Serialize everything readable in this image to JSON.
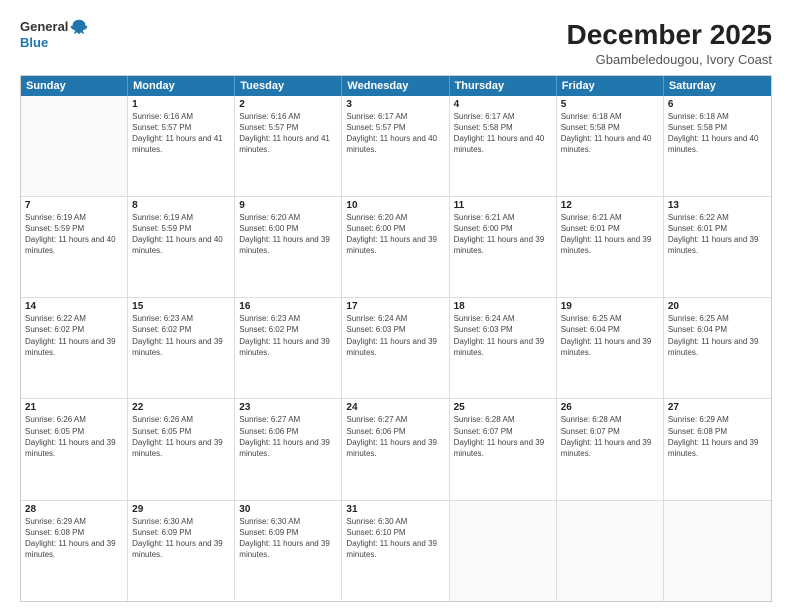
{
  "header": {
    "logo_line1": "General",
    "logo_line2": "Blue",
    "title": "December 2025",
    "subtitle": "Gbambeledougou, Ivory Coast"
  },
  "days_of_week": [
    "Sunday",
    "Monday",
    "Tuesday",
    "Wednesday",
    "Thursday",
    "Friday",
    "Saturday"
  ],
  "weeks": [
    [
      {
        "day": "",
        "sunrise": "",
        "sunset": "",
        "daylight": ""
      },
      {
        "day": "1",
        "sunrise": "Sunrise: 6:16 AM",
        "sunset": "Sunset: 5:57 PM",
        "daylight": "Daylight: 11 hours and 41 minutes."
      },
      {
        "day": "2",
        "sunrise": "Sunrise: 6:16 AM",
        "sunset": "Sunset: 5:57 PM",
        "daylight": "Daylight: 11 hours and 41 minutes."
      },
      {
        "day": "3",
        "sunrise": "Sunrise: 6:17 AM",
        "sunset": "Sunset: 5:57 PM",
        "daylight": "Daylight: 11 hours and 40 minutes."
      },
      {
        "day": "4",
        "sunrise": "Sunrise: 6:17 AM",
        "sunset": "Sunset: 5:58 PM",
        "daylight": "Daylight: 11 hours and 40 minutes."
      },
      {
        "day": "5",
        "sunrise": "Sunrise: 6:18 AM",
        "sunset": "Sunset: 5:58 PM",
        "daylight": "Daylight: 11 hours and 40 minutes."
      },
      {
        "day": "6",
        "sunrise": "Sunrise: 6:18 AM",
        "sunset": "Sunset: 5:58 PM",
        "daylight": "Daylight: 11 hours and 40 minutes."
      }
    ],
    [
      {
        "day": "7",
        "sunrise": "Sunrise: 6:19 AM",
        "sunset": "Sunset: 5:59 PM",
        "daylight": "Daylight: 11 hours and 40 minutes."
      },
      {
        "day": "8",
        "sunrise": "Sunrise: 6:19 AM",
        "sunset": "Sunset: 5:59 PM",
        "daylight": "Daylight: 11 hours and 40 minutes."
      },
      {
        "day": "9",
        "sunrise": "Sunrise: 6:20 AM",
        "sunset": "Sunset: 6:00 PM",
        "daylight": "Daylight: 11 hours and 39 minutes."
      },
      {
        "day": "10",
        "sunrise": "Sunrise: 6:20 AM",
        "sunset": "Sunset: 6:00 PM",
        "daylight": "Daylight: 11 hours and 39 minutes."
      },
      {
        "day": "11",
        "sunrise": "Sunrise: 6:21 AM",
        "sunset": "Sunset: 6:00 PM",
        "daylight": "Daylight: 11 hours and 39 minutes."
      },
      {
        "day": "12",
        "sunrise": "Sunrise: 6:21 AM",
        "sunset": "Sunset: 6:01 PM",
        "daylight": "Daylight: 11 hours and 39 minutes."
      },
      {
        "day": "13",
        "sunrise": "Sunrise: 6:22 AM",
        "sunset": "Sunset: 6:01 PM",
        "daylight": "Daylight: 11 hours and 39 minutes."
      }
    ],
    [
      {
        "day": "14",
        "sunrise": "Sunrise: 6:22 AM",
        "sunset": "Sunset: 6:02 PM",
        "daylight": "Daylight: 11 hours and 39 minutes."
      },
      {
        "day": "15",
        "sunrise": "Sunrise: 6:23 AM",
        "sunset": "Sunset: 6:02 PM",
        "daylight": "Daylight: 11 hours and 39 minutes."
      },
      {
        "day": "16",
        "sunrise": "Sunrise: 6:23 AM",
        "sunset": "Sunset: 6:02 PM",
        "daylight": "Daylight: 11 hours and 39 minutes."
      },
      {
        "day": "17",
        "sunrise": "Sunrise: 6:24 AM",
        "sunset": "Sunset: 6:03 PM",
        "daylight": "Daylight: 11 hours and 39 minutes."
      },
      {
        "day": "18",
        "sunrise": "Sunrise: 6:24 AM",
        "sunset": "Sunset: 6:03 PM",
        "daylight": "Daylight: 11 hours and 39 minutes."
      },
      {
        "day": "19",
        "sunrise": "Sunrise: 6:25 AM",
        "sunset": "Sunset: 6:04 PM",
        "daylight": "Daylight: 11 hours and 39 minutes."
      },
      {
        "day": "20",
        "sunrise": "Sunrise: 6:25 AM",
        "sunset": "Sunset: 6:04 PM",
        "daylight": "Daylight: 11 hours and 39 minutes."
      }
    ],
    [
      {
        "day": "21",
        "sunrise": "Sunrise: 6:26 AM",
        "sunset": "Sunset: 6:05 PM",
        "daylight": "Daylight: 11 hours and 39 minutes."
      },
      {
        "day": "22",
        "sunrise": "Sunrise: 6:26 AM",
        "sunset": "Sunset: 6:05 PM",
        "daylight": "Daylight: 11 hours and 39 minutes."
      },
      {
        "day": "23",
        "sunrise": "Sunrise: 6:27 AM",
        "sunset": "Sunset: 6:06 PM",
        "daylight": "Daylight: 11 hours and 39 minutes."
      },
      {
        "day": "24",
        "sunrise": "Sunrise: 6:27 AM",
        "sunset": "Sunset: 6:06 PM",
        "daylight": "Daylight: 11 hours and 39 minutes."
      },
      {
        "day": "25",
        "sunrise": "Sunrise: 6:28 AM",
        "sunset": "Sunset: 6:07 PM",
        "daylight": "Daylight: 11 hours and 39 minutes."
      },
      {
        "day": "26",
        "sunrise": "Sunrise: 6:28 AM",
        "sunset": "Sunset: 6:07 PM",
        "daylight": "Daylight: 11 hours and 39 minutes."
      },
      {
        "day": "27",
        "sunrise": "Sunrise: 6:29 AM",
        "sunset": "Sunset: 6:08 PM",
        "daylight": "Daylight: 11 hours and 39 minutes."
      }
    ],
    [
      {
        "day": "28",
        "sunrise": "Sunrise: 6:29 AM",
        "sunset": "Sunset: 6:08 PM",
        "daylight": "Daylight: 11 hours and 39 minutes."
      },
      {
        "day": "29",
        "sunrise": "Sunrise: 6:30 AM",
        "sunset": "Sunset: 6:09 PM",
        "daylight": "Daylight: 11 hours and 39 minutes."
      },
      {
        "day": "30",
        "sunrise": "Sunrise: 6:30 AM",
        "sunset": "Sunset: 6:09 PM",
        "daylight": "Daylight: 11 hours and 39 minutes."
      },
      {
        "day": "31",
        "sunrise": "Sunrise: 6:30 AM",
        "sunset": "Sunset: 6:10 PM",
        "daylight": "Daylight: 11 hours and 39 minutes."
      },
      {
        "day": "",
        "sunrise": "",
        "sunset": "",
        "daylight": ""
      },
      {
        "day": "",
        "sunrise": "",
        "sunset": "",
        "daylight": ""
      },
      {
        "day": "",
        "sunrise": "",
        "sunset": "",
        "daylight": ""
      }
    ]
  ]
}
